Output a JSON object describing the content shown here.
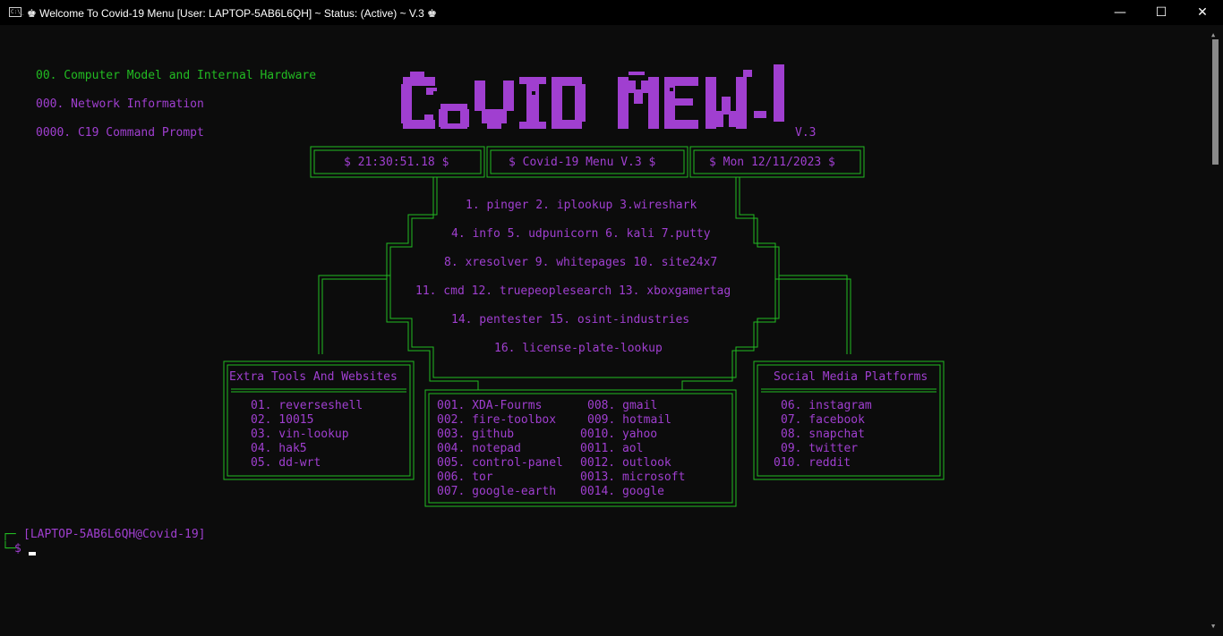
{
  "window": {
    "title": "♚ Welcome To Covid-19 Menu [User: LAPTOP-5AB6L6QH] ~ Status: (Active) ~ V.3 ♚",
    "app_icon_text": "C:\\_",
    "minimize_glyph": "—",
    "maximize_glyph": "☐",
    "close_glyph": "✕"
  },
  "header_menu": [
    "00. Computer Model and Internal Hardware",
    "000. Network Information",
    "0000. C19 Command Prompt"
  ],
  "logo": {
    "text": "CoVID MEW",
    "version": "V.3"
  },
  "status_bar": {
    "time": "$ 21:30:51.18 $",
    "menu": "$ Covid-19 Menu V.3 $",
    "date": "$ Mon 12/11/2023 $"
  },
  "main_options": [
    "1. pinger 2. iplookup 3.wireshark",
    "4. info 5. udpunicorn 6. kali 7.putty",
    "8. xresolver 9. whitepages 10. site24x7",
    "11. cmd 12. truepeoplesearch 13. xboxgamertag",
    "14. pentester 15. osint-industries",
    "16. license-plate-lookup"
  ],
  "extra_tools": {
    "title": "Extra Tools And Websites",
    "items": [
      "01. reverseshell",
      "02. 10015",
      "03. vin-lookup",
      "04. hak5",
      "05. dd-wrt"
    ]
  },
  "sites": {
    "left": [
      "001. XDA-Fourms",
      "002. fire-toolbox",
      "003. github",
      "004. notepad",
      "005. control-panel",
      "006. tor",
      "007. google-earth"
    ],
    "right": [
      "008. gmail",
      "009. hotmail",
      "0010. yahoo",
      "0011. aol",
      "0012. outlook",
      "0013. microsoft",
      "0014. google"
    ]
  },
  "social": {
    "title": "Social Media Platforms",
    "items": [
      "06. instagram",
      "07. facebook",
      "08. snapchat",
      "09. twitter",
      "010. reddit"
    ]
  },
  "prompt": {
    "corner_top": "┌─",
    "user": "[LAPTOP-5AB6L6QH@Covid-19]",
    "corner_bottom": "└─",
    "symbol": "$"
  },
  "colors": {
    "purple": "#a03fd0",
    "green": "#22bb22",
    "background": "#0c0c0c"
  }
}
